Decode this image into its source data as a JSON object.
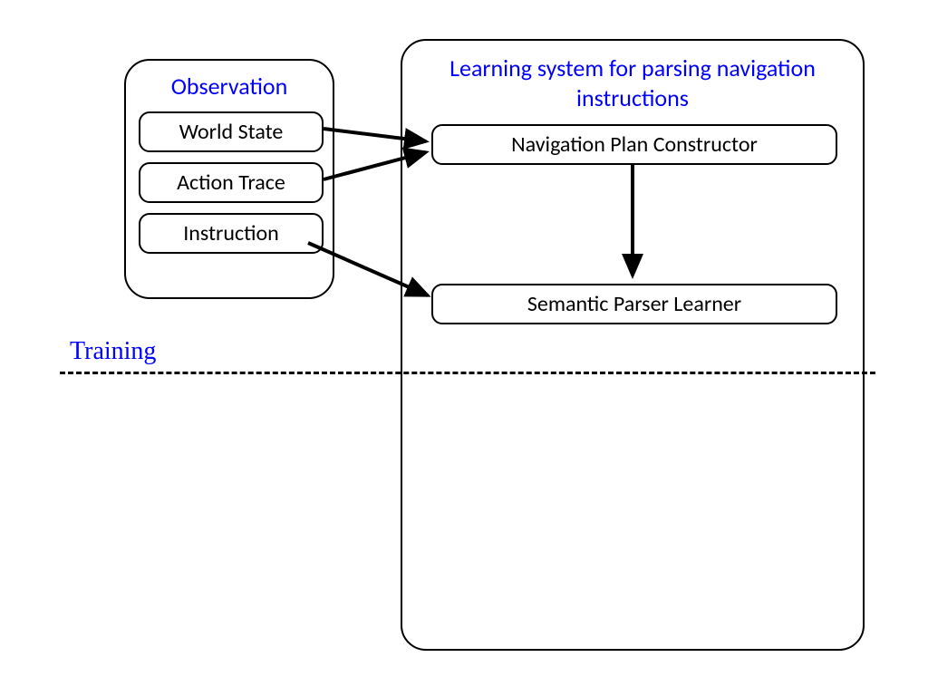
{
  "observation": {
    "title": "Observation",
    "items": {
      "world_state": "World State",
      "action_trace": "Action Trace",
      "instruction": "Instruction"
    }
  },
  "learning_system": {
    "title": "Learning system for parsing navigation instructions",
    "nav_plan": "Navigation Plan Constructor",
    "semantic_parser": "Semantic Parser Learner"
  },
  "labels": {
    "training": "Training"
  }
}
